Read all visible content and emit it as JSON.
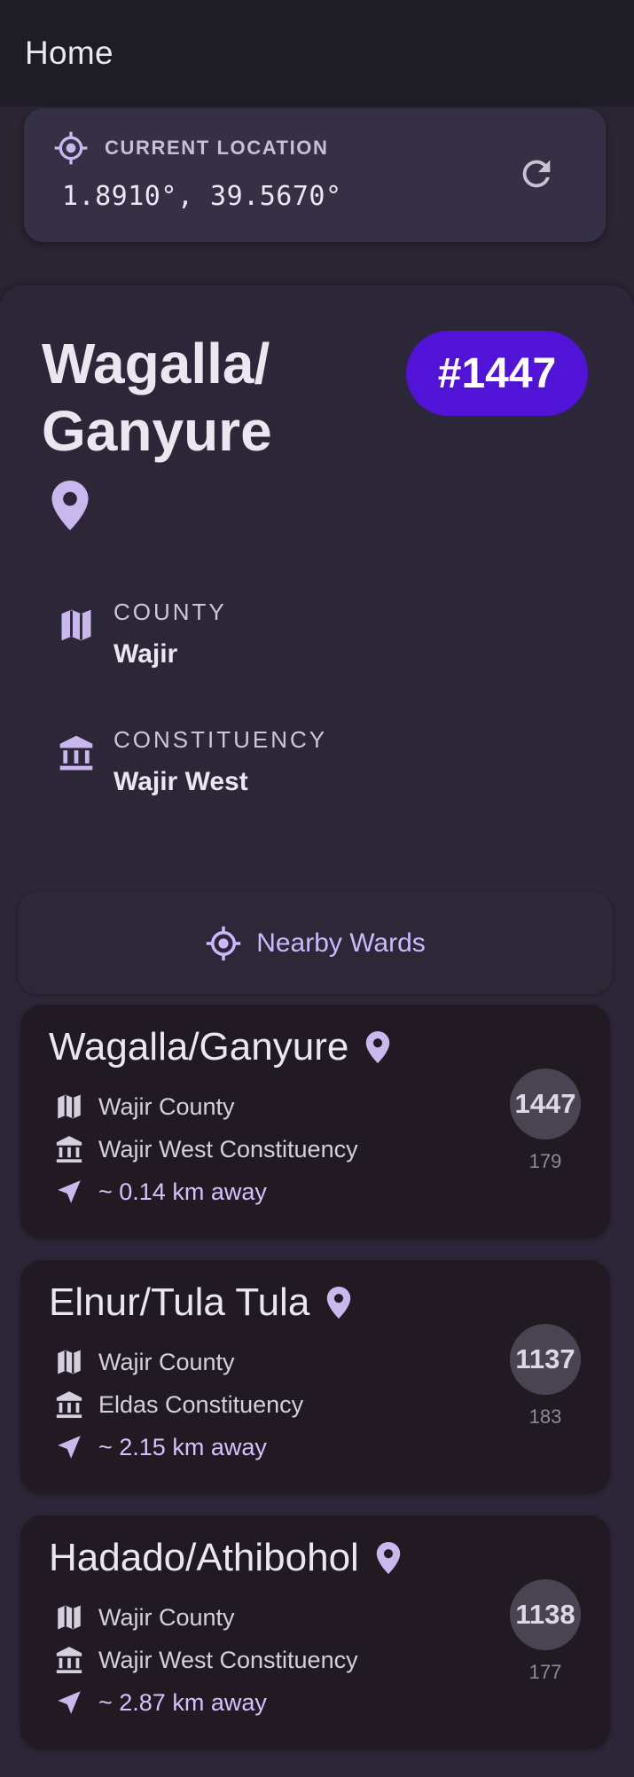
{
  "appbar": {
    "title": "Home"
  },
  "location": {
    "label": "CURRENT LOCATION",
    "coords": "1.8910°, 39.5670°"
  },
  "ward": {
    "name": "Wagalla/ Ganyure",
    "badge": "#1447",
    "county_label": "COUNTY",
    "county": "Wajir",
    "constituency_label": "CONSTITUENCY",
    "constituency": "Wajir West"
  },
  "nearby": {
    "button_label": "Nearby Wards",
    "items": [
      {
        "name": "Wagalla/Ganyure",
        "county": "Wajir County",
        "constituency": "Wajir West Constituency",
        "distance": "~ 0.14 km away",
        "code": "1447",
        "sub": "179"
      },
      {
        "name": "Elnur/Tula Tula",
        "county": "Wajir County",
        "constituency": "Eldas Constituency",
        "distance": "~ 2.15 km away",
        "code": "1137",
        "sub": "183"
      },
      {
        "name": "Hadado/Athibohol",
        "county": "Wajir County",
        "constituency": "Wajir West Constituency",
        "distance": "~ 2.87 km away",
        "code": "1138",
        "sub": "177"
      }
    ]
  },
  "colors": {
    "accent": "#cdb8ff",
    "badge": "#5213d8",
    "background": "#2a2433"
  },
  "icons": [
    "my-location-icon",
    "refresh-icon",
    "pin-icon",
    "map-icon",
    "bank-icon",
    "navigation-icon"
  ]
}
